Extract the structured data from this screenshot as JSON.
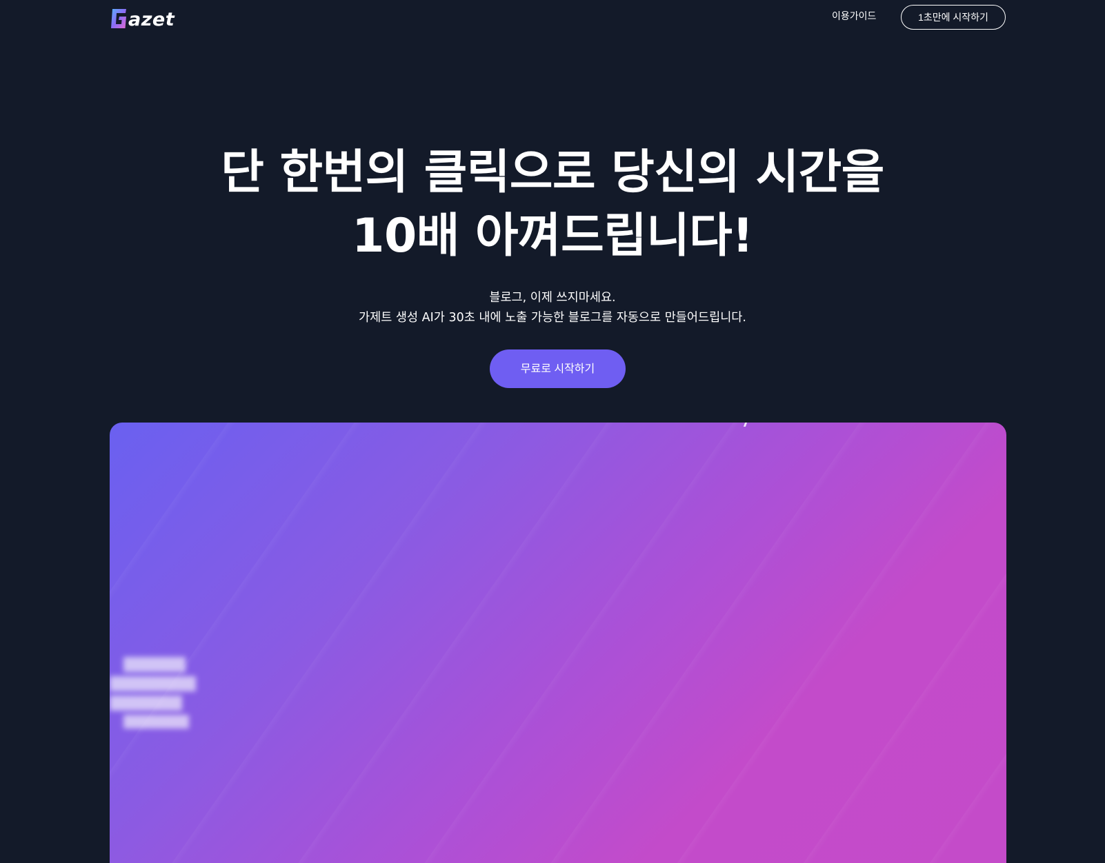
{
  "header": {
    "logo_text": "azet",
    "nav_guide": "이용가이드",
    "nav_cta": "1초만에 시작하기"
  },
  "hero": {
    "title_line1": "단 한번의 클릭으로 당신의 시간을",
    "title_line2": "10배 아껴드립니다!",
    "sub_line1": "블로그, 이제 쓰지마세요.",
    "sub_line2": "가제트 생성 AI가 30초 내에 노출 가능한 블로그를 자동으로 만들어드립니다.",
    "cta": "무료로 시작하기"
  },
  "colors": {
    "background": "#131a29",
    "accent": "#6f5ef2",
    "gradient_start": "#6a60f0",
    "gradient_end": "#c44bc9"
  }
}
